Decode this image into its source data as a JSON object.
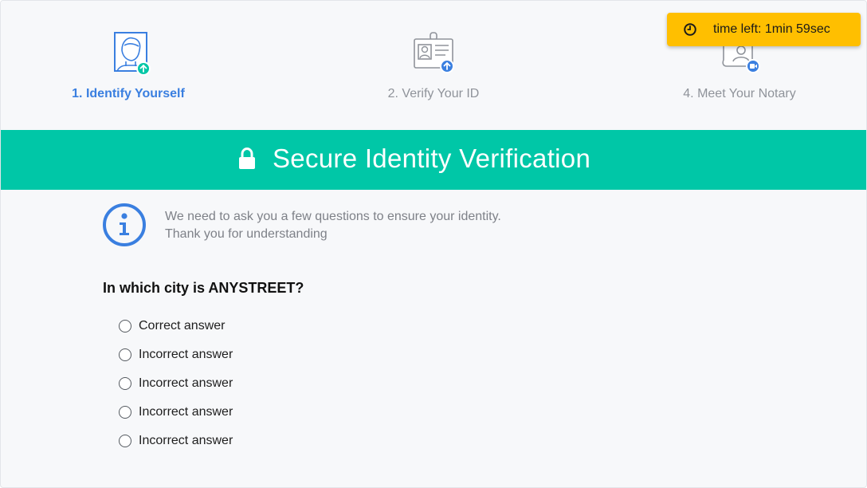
{
  "steps": [
    {
      "label": "1. Identify Yourself",
      "icon": "person-upload-icon",
      "active": true
    },
    {
      "label": "2. Verify Your ID",
      "icon": "id-card-upload-icon",
      "active": false
    },
    {
      "label": "4. Meet Your Notary",
      "icon": "notary-video-icon",
      "active": false
    }
  ],
  "timer": {
    "text": "time left: 1min 59sec",
    "icon": "clock-icon",
    "color": "#ffbf00"
  },
  "banner": {
    "title": "Secure Identity Verification",
    "icon": "lock-icon",
    "color": "#00c7a7"
  },
  "info": {
    "icon": "info-icon",
    "line1": "We need to ask you a few questions to ensure your identity.",
    "line2": "Thank you for understanding"
  },
  "question": {
    "text": "In which city is ANYSTREET?",
    "options": [
      "Correct answer",
      "Incorrect answer",
      "Incorrect answer",
      "Incorrect answer",
      "Incorrect answer"
    ],
    "selected": null
  },
  "colors": {
    "accent": "#3a7fe0",
    "upload_badge": "#00c7a7",
    "muted": "#8f939a"
  }
}
